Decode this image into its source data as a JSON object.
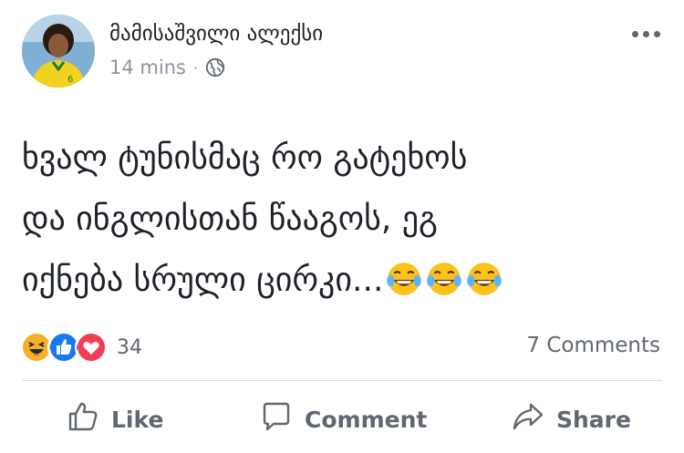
{
  "post": {
    "author": "მამისაშვილი ალექსი",
    "time": "14 mins",
    "separator": "·",
    "privacy_icon": "globe-icon",
    "text_lines": [
      "ხვალ ტუნისმაც რო გატეხოს",
      "და ინგლისთან წააგოს, ეგ",
      "იქნება სრული ცირკი..."
    ],
    "trailing_emoji": "face-with-tears-of-joy-icon"
  },
  "engagement": {
    "reactions": [
      "haha-icon",
      "like-icon",
      "love-icon"
    ],
    "reaction_count": "34",
    "comments": "7 Comments"
  },
  "actions": {
    "like": "Like",
    "comment": "Comment",
    "share": "Share"
  },
  "colors": {
    "text": "#1d2129",
    "muted": "#606770",
    "like_blue": "#1877f2",
    "love_red": "#f33e58",
    "haha_yellow": "#f7b125"
  }
}
